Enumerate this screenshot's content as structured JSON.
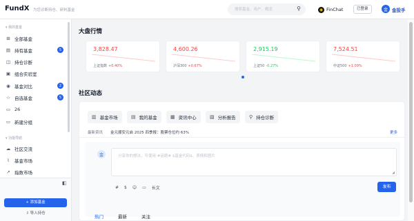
{
  "header": {
    "logo": "FundX",
    "tagline": "为您诊断持仓、研判基金",
    "search_placeholder": "搜索基金、用户、概念",
    "finchat_label": "FinChat",
    "login_status": "已登录",
    "user_initial": "金",
    "user_name": "金投手"
  },
  "sidebar": {
    "section_my_funds": "▾ 我的基金",
    "items": [
      {
        "label": "全部基金",
        "icon": "grid-icon",
        "glyph": "⊞"
      },
      {
        "label": "持有基金",
        "icon": "holdings-icon",
        "glyph": "▤",
        "badge": "5"
      },
      {
        "label": "持仓诊断",
        "icon": "diagnosis-icon",
        "glyph": "◫"
      },
      {
        "label": "组合实验室",
        "icon": "lab-icon",
        "glyph": "▣"
      },
      {
        "label": "基金对比",
        "icon": "compare-icon",
        "glyph": "◉",
        "badge": "2"
      },
      {
        "label": "自选基金",
        "icon": "star-icon",
        "glyph": "☆",
        "badge": "5"
      },
      {
        "label": "26",
        "icon": "folder-icon",
        "glyph": "▭"
      },
      {
        "label": "新建分组",
        "icon": "new-folder-icon",
        "glyph": "▭"
      }
    ],
    "section_features": "▾ 功能导航",
    "feature_items": [
      {
        "label": "社区交流",
        "icon": "community-icon",
        "glyph": "☁"
      },
      {
        "label": "基金市场",
        "icon": "market-icon",
        "glyph": "⌇"
      },
      {
        "label": "指数市场",
        "icon": "index-icon",
        "glyph": "↗"
      }
    ],
    "add_fund_label": "+ 添加基金",
    "import_label": "⇩ 导入持仓"
  },
  "market": {
    "title": "大盘行情",
    "cards": [
      {
        "value": "3,828.47",
        "name": "上证指数",
        "change": "+0.40%",
        "color": "#ef4444",
        "trend": "down"
      },
      {
        "value": "4,600.26",
        "name": "沪深300",
        "change": "+0.67%",
        "color": "#ef4444",
        "trend": "down"
      },
      {
        "value": "2,915.19",
        "name": "上证50",
        "change": "-0.27%",
        "color": "#22c55e",
        "trend": "down"
      },
      {
        "value": "7,524.51",
        "name": "中证500",
        "change": "+1.09%",
        "color": "#ef4444",
        "trend": "down"
      }
    ]
  },
  "community": {
    "title": "社区动态",
    "quick_buttons": [
      {
        "label": "基金市场",
        "icon": "chart-icon",
        "glyph": "▥"
      },
      {
        "label": "我的基金",
        "icon": "wallet-icon",
        "glyph": "▤"
      },
      {
        "label": "资讯中心",
        "icon": "news-icon",
        "glyph": "▦"
      },
      {
        "label": "分析报告",
        "icon": "report-icon",
        "glyph": "▧"
      },
      {
        "label": "持仓诊断",
        "icon": "search-icon",
        "glyph": "⚲"
      }
    ],
    "news_label": "最新资讯",
    "news_text": "金元顺安元启 2025 四季报：股票仓位约 63%",
    "more_label": "更多",
    "composer_avatar": "金",
    "composer_placeholder": "分享你的想法，可使用 #话题# $基金代码$、表情和图片",
    "tools": [
      "#",
      "$",
      "☺",
      "▭",
      "长文"
    ],
    "publish_label": "发布",
    "feed_tabs": [
      "热门",
      "最新",
      "关注"
    ]
  }
}
